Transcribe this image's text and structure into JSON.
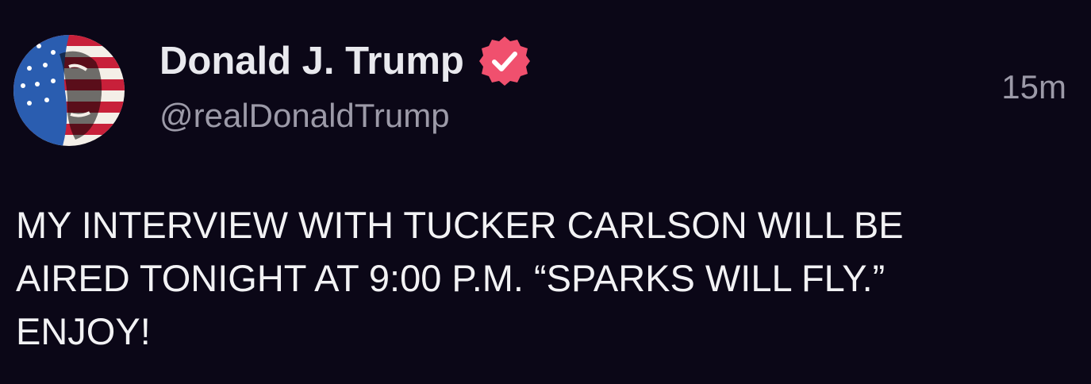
{
  "author": {
    "display_name": "Donald J. Trump",
    "handle": "@realDonaldTrump",
    "verified": true,
    "avatar_icon": "flag-portrait-avatar",
    "verified_icon": "verified-badge-icon"
  },
  "post": {
    "timestamp": "15m",
    "lines": [
      "MY INTERVIEW WITH TUCKER CARLSON WILL BE",
      "AIRED TONIGHT AT 9:00 P.M. “SPARKS WILL FLY.”",
      "ENJOY!"
    ]
  },
  "colors": {
    "background": "#0b0717",
    "text_primary": "#f2f2f4",
    "text_secondary": "#9c9aa8",
    "verified_badge": "#f0506e"
  }
}
